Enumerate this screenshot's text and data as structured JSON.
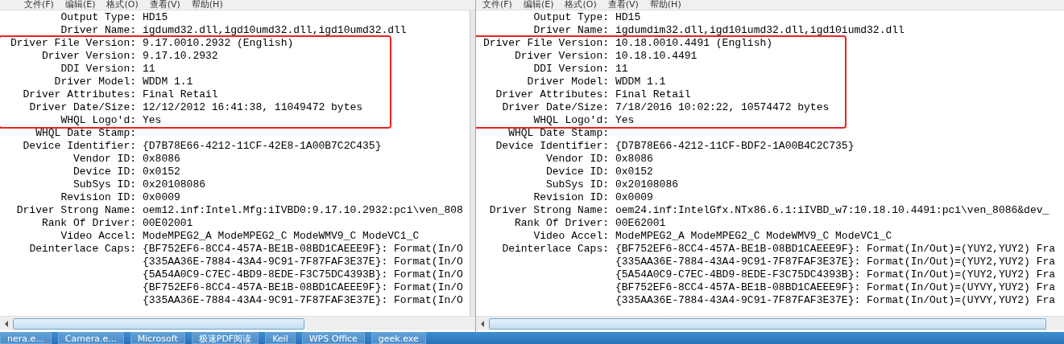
{
  "windows": [
    {
      "menu": [
        "文件(F)",
        "编辑(E)",
        "格式(O)",
        "查看(V)",
        "帮助(H)"
      ],
      "sections": [
        {
          "highlighted": false,
          "rows": [
            {
              "label": "Output Type:",
              "values": [
                "HD15"
              ]
            },
            {
              "label": "Driver Name:",
              "values": [
                "igdumd32.dll,igd10umd32.dll,igd10umd32.dll"
              ]
            }
          ]
        },
        {
          "highlighted": true,
          "rows": [
            {
              "label": "Driver File Version:",
              "values": [
                "9.17.0010.2932 (English)"
              ]
            },
            {
              "label": "Driver Version:",
              "values": [
                "9.17.10.2932"
              ]
            },
            {
              "label": "DDI Version:",
              "values": [
                "11"
              ]
            },
            {
              "label": "Driver Model:",
              "values": [
                "WDDM 1.1"
              ]
            },
            {
              "label": "Driver Attributes:",
              "values": [
                "Final Retail"
              ]
            },
            {
              "label": "Driver Date/Size:",
              "values": [
                "12/12/2012 16:41:38, 11049472 bytes"
              ]
            },
            {
              "label": "WHQL Logo'd:",
              "values": [
                "Yes"
              ]
            }
          ]
        },
        {
          "highlighted": false,
          "rows": [
            {
              "label": "WHQL Date Stamp:",
              "values": []
            },
            {
              "label": "Device Identifier:",
              "values": [
                "{D7B78E66-4212-11CF-42E8-1A00B7C2C435}"
              ]
            },
            {
              "label": "Vendor ID:",
              "values": [
                "0x8086"
              ]
            },
            {
              "label": "Device ID:",
              "values": [
                "0x0152"
              ]
            },
            {
              "label": "SubSys ID:",
              "values": [
                "0x20108086"
              ]
            },
            {
              "label": "Revision ID:",
              "values": [
                "0x0009"
              ]
            },
            {
              "label": "Driver Strong Name:",
              "values": [
                "oem12.inf:Intel.Mfg:iIVBD0:9.17.10.2932:pci\\ven_808"
              ]
            },
            {
              "label": "Rank Of Driver:",
              "values": [
                "00E02001"
              ]
            },
            {
              "label": "Video Accel:",
              "values": [
                "ModeMPEG2_A ModeMPEG2_C ModeWMV9_C ModeVC1_C"
              ]
            },
            {
              "label": "Deinterlace Caps:",
              "values": [
                "{BF752EF6-8CC4-457A-BE1B-08BD1CAEEE9F}: Format(In/O",
                "{335AA36E-7884-43A4-9C91-7F87FAF3E37E}: Format(In/O",
                "{5A54A0C9-C7EC-4BD9-8EDE-F3C75DC4393B}: Format(In/O",
                "{BF752EF6-8CC4-457A-BE1B-08BD1CAEEE9F}: Format(In/O",
                "{335AA36E-7884-43A4-9C91-7F87FAF3E37E}: Format(In/O"
              ]
            }
          ]
        }
      ]
    },
    {
      "menu": [
        "文件(F)",
        "编辑(E)",
        "格式(O)",
        "查看(V)",
        "帮助(H)"
      ],
      "sections": [
        {
          "highlighted": false,
          "rows": [
            {
              "label": "Output Type:",
              "values": [
                "HD15"
              ]
            },
            {
              "label": "Driver Name:",
              "values": [
                "igdumdim32.dll,igd10iumd32.dll,igd10iumd32.dll"
              ]
            }
          ]
        },
        {
          "highlighted": true,
          "rows": [
            {
              "label": "Driver File Version:",
              "values": [
                "10.18.0010.4491 (English)"
              ]
            },
            {
              "label": "Driver Version:",
              "values": [
                "10.18.10.4491"
              ]
            },
            {
              "label": "DDI Version:",
              "values": [
                "11"
              ]
            },
            {
              "label": "Driver Model:",
              "values": [
                "WDDM 1.1"
              ]
            },
            {
              "label": "Driver Attributes:",
              "values": [
                "Final Retail"
              ]
            },
            {
              "label": "Driver Date/Size:",
              "values": [
                "7/18/2016 10:02:22, 10574472 bytes"
              ]
            },
            {
              "label": "WHQL Logo'd:",
              "values": [
                "Yes"
              ]
            }
          ]
        },
        {
          "highlighted": false,
          "rows": [
            {
              "label": "WHQL Date Stamp:",
              "values": []
            },
            {
              "label": "Device Identifier:",
              "values": [
                "{D7B78E66-4212-11CF-BDF2-1A00B4C2C735}"
              ]
            },
            {
              "label": "Vendor ID:",
              "values": [
                "0x8086"
              ]
            },
            {
              "label": "Device ID:",
              "values": [
                "0x0152"
              ]
            },
            {
              "label": "SubSys ID:",
              "values": [
                "0x20108086"
              ]
            },
            {
              "label": "Revision ID:",
              "values": [
                "0x0009"
              ]
            },
            {
              "label": "Driver Strong Name:",
              "values": [
                "oem24.inf:IntelGfx.NTx86.6.1:iIVBD_w7:10.18.10.4491:pci\\ven_8086&dev_"
              ]
            },
            {
              "label": "Rank Of Driver:",
              "values": [
                "00E62001"
              ]
            },
            {
              "label": "Video Accel:",
              "values": [
                "ModeMPEG2_A ModeMPEG2_C ModeWMV9_C ModeVC1_C"
              ]
            },
            {
              "label": "Deinterlace Caps:",
              "values": [
                "{BF752EF6-8CC4-457A-BE1B-08BD1CAEEE9F}: Format(In/Out)=(YUY2,YUY2) Fra",
                "{335AA36E-7884-43A4-9C91-7F87FAF3E37E}: Format(In/Out)=(YUY2,YUY2) Fra",
                "{5A54A0C9-C7EC-4BD9-8EDE-F3C75DC4393B}: Format(In/Out)=(YUY2,YUY2) Fra",
                "{BF752EF6-8CC4-457A-BE1B-08BD1CAEEE9F}: Format(In/Out)=(UYVY,YUY2) Fra",
                "{335AA36E-7884-43A4-9C91-7F87FAF3E37E}: Format(In/Out)=(UYVY,YUY2) Fra"
              ]
            }
          ]
        }
      ]
    }
  ],
  "taskbar": [
    "nera.e...",
    "Camera.e...",
    "Microsoft",
    "极速PDF阅读",
    "Keil",
    "WPS Office",
    "geek.exe"
  ]
}
